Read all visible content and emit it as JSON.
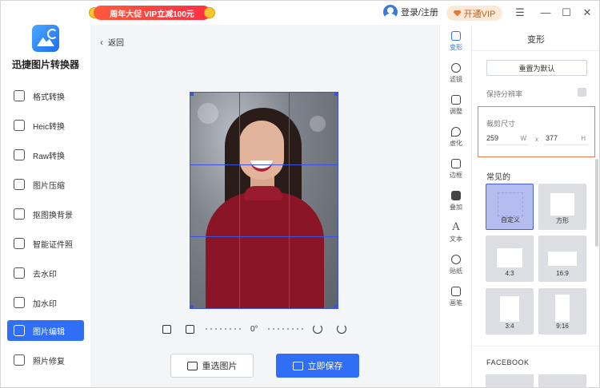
{
  "titlebar": {
    "promo": "周年大促 VIP立减100元",
    "login": "登录/注册",
    "vip": "开通VIP",
    "buttons": [
      "☰",
      "—",
      "☐",
      "✕"
    ]
  },
  "sidebar": {
    "app_name": "迅捷图片转换器",
    "items": [
      {
        "label": "格式转换",
        "icon": "swap-icon"
      },
      {
        "label": "Heic转换",
        "icon": "heic-icon"
      },
      {
        "label": "Raw转换",
        "icon": "raw-icon"
      },
      {
        "label": "图片压缩",
        "icon": "compress-icon"
      },
      {
        "label": "抠图换背景",
        "icon": "cutout-icon"
      },
      {
        "label": "智能证件照",
        "icon": "id-photo-icon"
      },
      {
        "label": "去水印",
        "icon": "remove-watermark-icon"
      },
      {
        "label": "加水印",
        "icon": "add-watermark-icon"
      },
      {
        "label": "图片编辑",
        "icon": "edit-image-icon",
        "active": true
      },
      {
        "label": "照片修复",
        "icon": "photo-repair-icon"
      }
    ]
  },
  "canvas": {
    "back_label": "返回",
    "rotation": "0°",
    "reselect_label": "重选图片",
    "save_label": "立即保存"
  },
  "tools": [
    {
      "label": "变形",
      "active": true
    },
    {
      "label": "滤镜"
    },
    {
      "label": "调整"
    },
    {
      "label": "虚化"
    },
    {
      "label": "边框"
    },
    {
      "label": "叠加"
    },
    {
      "label": "文本"
    },
    {
      "label": "贴纸"
    },
    {
      "label": "画笔"
    }
  ],
  "panel": {
    "title": "变形",
    "reset_label": "重置为默认",
    "keep_resolution_label": "保持分辨率",
    "crop_size_label": "裁剪尺寸",
    "width_value": "259",
    "width_unit": "W",
    "separator": "x",
    "height_value": "377",
    "height_unit": "H",
    "common_label": "常见的",
    "presets": [
      "自定义",
      "方形",
      "4:3",
      "16:9",
      "3:4",
      "9:16"
    ],
    "facebook_label": "FACEBOOK"
  },
  "colors": {
    "accent": "#2f6ef5",
    "crop_highlight": "#f27a4b",
    "grid": "#3c53e0"
  }
}
